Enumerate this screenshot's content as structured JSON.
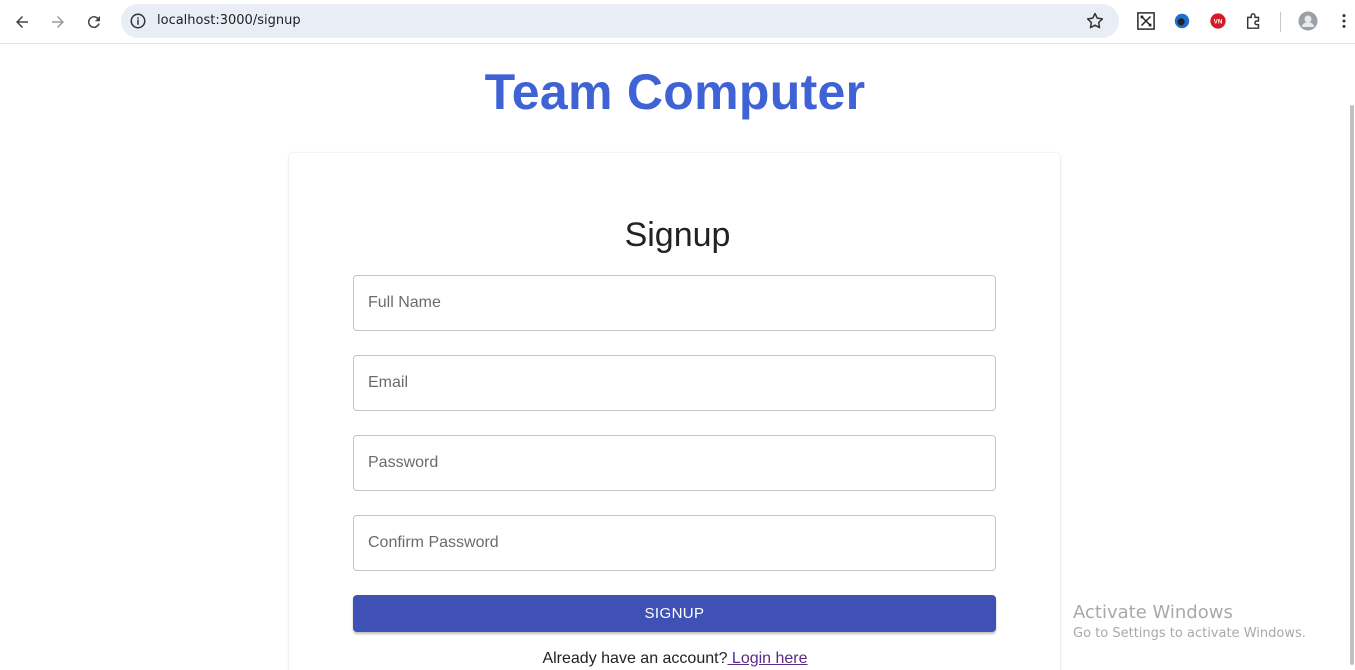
{
  "browser": {
    "url": "localhost:3000/signup",
    "icons": [
      "back-icon",
      "forward-icon",
      "reload-icon",
      "site-info-icon",
      "bookmark-star-icon",
      "qr-extension-icon",
      "globe-extension-icon",
      "vn-extension-icon",
      "puzzle-extensions-icon",
      "profile-avatar",
      "menu-kebab-icon"
    ]
  },
  "page": {
    "brand": "Team Computer",
    "title": "Signup",
    "fields": {
      "full_name_placeholder": "Full Name",
      "email_placeholder": "Email",
      "password_placeholder": "Password",
      "confirm_password_placeholder": "Confirm Password"
    },
    "submit_label": "SIGNUP",
    "login_prompt": "Already have an account?",
    "login_link": " Login here"
  },
  "watermark": {
    "line1": "Activate Windows",
    "line2": "Go to Settings to activate Windows."
  },
  "colors": {
    "brand": "#3f63d4",
    "button": "#3f51b5",
    "link": "#5a2a86"
  }
}
